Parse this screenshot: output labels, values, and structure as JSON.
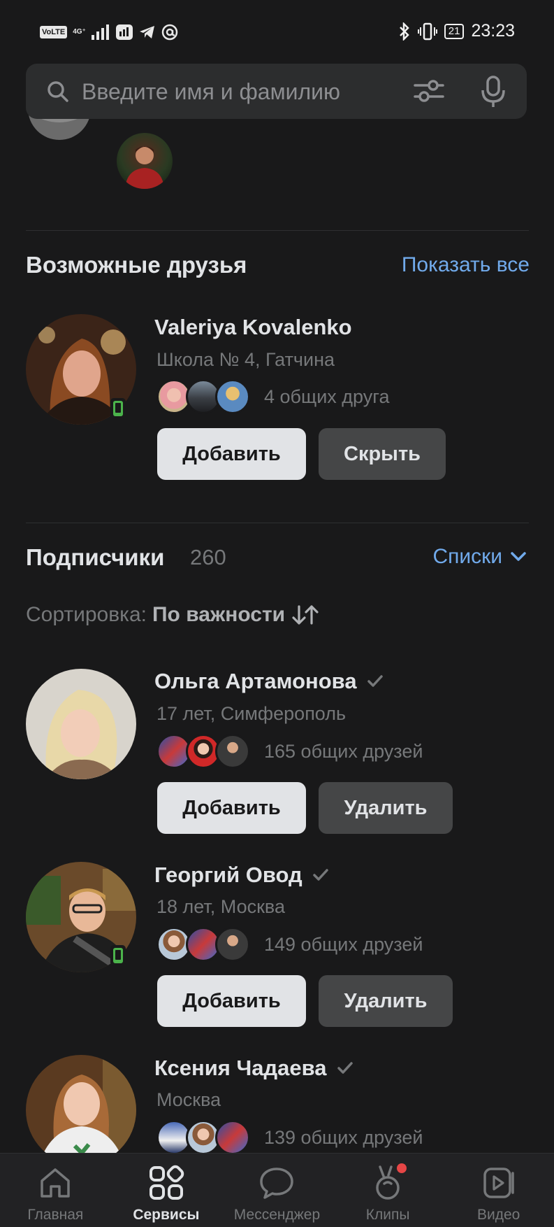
{
  "status_bar": {
    "time": "23:23",
    "battery": "21",
    "volte": "VoLTE",
    "network": "4G⁺"
  },
  "search": {
    "placeholder": "Введите имя и фамилию"
  },
  "possible_friends": {
    "title": "Возможные друзья",
    "show_all": "Показать все",
    "items": [
      {
        "name": "Valeriya Kovalenko",
        "subtitle": "Школа № 4, Гатчина",
        "mutual": "4 общих друга",
        "online": true,
        "add_label": "Добавить",
        "secondary_label": "Скрыть"
      }
    ]
  },
  "followers": {
    "title": "Подписчики",
    "count": "260",
    "lists_label": "Списки",
    "sort_label": "Сортировка:",
    "sort_value": "По важности",
    "items": [
      {
        "name": "Ольга Артамонова",
        "subtitle": "17 лет, Симферополь",
        "mutual": "165 общих друзей",
        "online": false,
        "add_label": "Добавить",
        "secondary_label": "Удалить"
      },
      {
        "name": "Георгий Овод",
        "subtitle": "18 лет, Москва",
        "mutual": "149 общих друзей",
        "online": true,
        "add_label": "Добавить",
        "secondary_label": "Удалить"
      },
      {
        "name": "Ксения Чадаева",
        "subtitle": "Москва",
        "mutual": "139 общих друзей",
        "online": false
      }
    ]
  },
  "tabbar": {
    "items": [
      {
        "label": "Главная",
        "icon": "home-icon",
        "active": false
      },
      {
        "label": "Сервисы",
        "icon": "services-icon",
        "active": true
      },
      {
        "label": "Мессенджер",
        "icon": "messenger-icon",
        "active": false
      },
      {
        "label": "Клипы",
        "icon": "clips-icon",
        "active": false,
        "badge": true
      },
      {
        "label": "Видео",
        "icon": "video-icon",
        "active": false
      }
    ]
  },
  "colors": {
    "background": "#19191a",
    "accent": "#71aaeb",
    "online": "#4bb34b",
    "badge": "#e64646"
  }
}
